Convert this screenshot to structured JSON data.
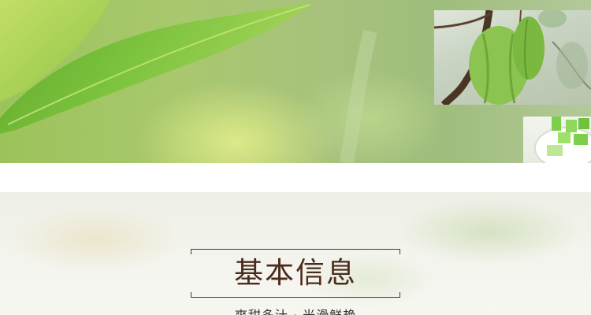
{
  "info_section": {
    "title": "基本信息",
    "subtitle": "爽甜多汁 · 光滑鲜艳"
  },
  "colors": {
    "banner_green": "#a6c27c",
    "leaf_green": "#7fc23a",
    "title_brown": "#4b2b1c",
    "fruit_green": "#7cc04a"
  },
  "images": {
    "banner_photo": "green-leaf-photo",
    "tree_photo": "carambola-on-branch-photo",
    "cup_photo": "carambola-drink-photo"
  }
}
